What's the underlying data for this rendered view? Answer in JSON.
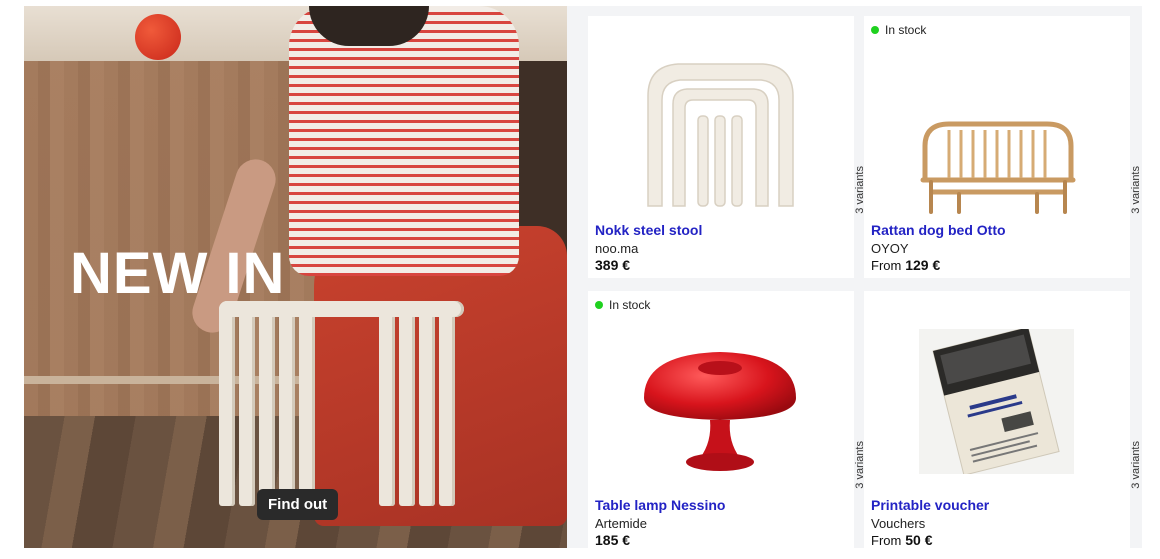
{
  "hero": {
    "title": "NEW IN",
    "cta_label": "Find out"
  },
  "products": [
    {
      "name": "Nokk steel stool",
      "brand": "noo.ma",
      "price_prefix": "",
      "price": "389 €",
      "variants": "3 variants",
      "stock": "",
      "icon": "stool-image"
    },
    {
      "name": "Rattan dog bed Otto",
      "brand": "OYOY",
      "price_prefix": "From",
      "price": "129 €",
      "variants": "3 variants",
      "stock": "In stock",
      "icon": "dog-bed-image"
    },
    {
      "name": "Table lamp Nessino",
      "brand": "Artemide",
      "price_prefix": "",
      "price": "185 €",
      "variants": "3 variants",
      "stock": "In stock",
      "icon": "lamp-image"
    },
    {
      "name": "Printable voucher",
      "brand": "Vouchers",
      "price_prefix": "From",
      "price": "50 €",
      "variants": "3 variants",
      "stock": "",
      "icon": "voucher-image"
    }
  ],
  "colors": {
    "product_link": "#2323c4",
    "stock_dot": "#1fd11f",
    "button_bg": "#2a2a2a"
  }
}
